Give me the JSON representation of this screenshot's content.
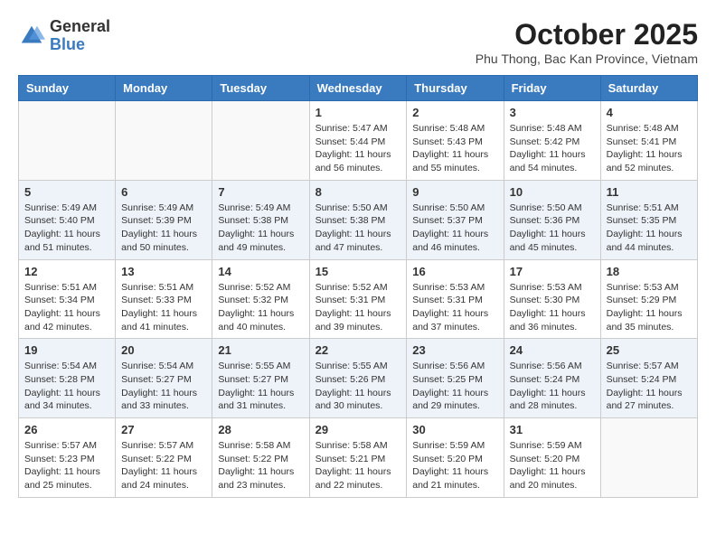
{
  "logo": {
    "general": "General",
    "blue": "Blue"
  },
  "title": "October 2025",
  "location": "Phu Thong, Bac Kan Province, Vietnam",
  "weekdays": [
    "Sunday",
    "Monday",
    "Tuesday",
    "Wednesday",
    "Thursday",
    "Friday",
    "Saturday"
  ],
  "weeks": [
    [
      {
        "day": "",
        "info": ""
      },
      {
        "day": "",
        "info": ""
      },
      {
        "day": "",
        "info": ""
      },
      {
        "day": "1",
        "info": "Sunrise: 5:47 AM\nSunset: 5:44 PM\nDaylight: 11 hours and 56 minutes."
      },
      {
        "day": "2",
        "info": "Sunrise: 5:48 AM\nSunset: 5:43 PM\nDaylight: 11 hours and 55 minutes."
      },
      {
        "day": "3",
        "info": "Sunrise: 5:48 AM\nSunset: 5:42 PM\nDaylight: 11 hours and 54 minutes."
      },
      {
        "day": "4",
        "info": "Sunrise: 5:48 AM\nSunset: 5:41 PM\nDaylight: 11 hours and 52 minutes."
      }
    ],
    [
      {
        "day": "5",
        "info": "Sunrise: 5:49 AM\nSunset: 5:40 PM\nDaylight: 11 hours and 51 minutes."
      },
      {
        "day": "6",
        "info": "Sunrise: 5:49 AM\nSunset: 5:39 PM\nDaylight: 11 hours and 50 minutes."
      },
      {
        "day": "7",
        "info": "Sunrise: 5:49 AM\nSunset: 5:38 PM\nDaylight: 11 hours and 49 minutes."
      },
      {
        "day": "8",
        "info": "Sunrise: 5:50 AM\nSunset: 5:38 PM\nDaylight: 11 hours and 47 minutes."
      },
      {
        "day": "9",
        "info": "Sunrise: 5:50 AM\nSunset: 5:37 PM\nDaylight: 11 hours and 46 minutes."
      },
      {
        "day": "10",
        "info": "Sunrise: 5:50 AM\nSunset: 5:36 PM\nDaylight: 11 hours and 45 minutes."
      },
      {
        "day": "11",
        "info": "Sunrise: 5:51 AM\nSunset: 5:35 PM\nDaylight: 11 hours and 44 minutes."
      }
    ],
    [
      {
        "day": "12",
        "info": "Sunrise: 5:51 AM\nSunset: 5:34 PM\nDaylight: 11 hours and 42 minutes."
      },
      {
        "day": "13",
        "info": "Sunrise: 5:51 AM\nSunset: 5:33 PM\nDaylight: 11 hours and 41 minutes."
      },
      {
        "day": "14",
        "info": "Sunrise: 5:52 AM\nSunset: 5:32 PM\nDaylight: 11 hours and 40 minutes."
      },
      {
        "day": "15",
        "info": "Sunrise: 5:52 AM\nSunset: 5:31 PM\nDaylight: 11 hours and 39 minutes."
      },
      {
        "day": "16",
        "info": "Sunrise: 5:53 AM\nSunset: 5:31 PM\nDaylight: 11 hours and 37 minutes."
      },
      {
        "day": "17",
        "info": "Sunrise: 5:53 AM\nSunset: 5:30 PM\nDaylight: 11 hours and 36 minutes."
      },
      {
        "day": "18",
        "info": "Sunrise: 5:53 AM\nSunset: 5:29 PM\nDaylight: 11 hours and 35 minutes."
      }
    ],
    [
      {
        "day": "19",
        "info": "Sunrise: 5:54 AM\nSunset: 5:28 PM\nDaylight: 11 hours and 34 minutes."
      },
      {
        "day": "20",
        "info": "Sunrise: 5:54 AM\nSunset: 5:27 PM\nDaylight: 11 hours and 33 minutes."
      },
      {
        "day": "21",
        "info": "Sunrise: 5:55 AM\nSunset: 5:27 PM\nDaylight: 11 hours and 31 minutes."
      },
      {
        "day": "22",
        "info": "Sunrise: 5:55 AM\nSunset: 5:26 PM\nDaylight: 11 hours and 30 minutes."
      },
      {
        "day": "23",
        "info": "Sunrise: 5:56 AM\nSunset: 5:25 PM\nDaylight: 11 hours and 29 minutes."
      },
      {
        "day": "24",
        "info": "Sunrise: 5:56 AM\nSunset: 5:24 PM\nDaylight: 11 hours and 28 minutes."
      },
      {
        "day": "25",
        "info": "Sunrise: 5:57 AM\nSunset: 5:24 PM\nDaylight: 11 hours and 27 minutes."
      }
    ],
    [
      {
        "day": "26",
        "info": "Sunrise: 5:57 AM\nSunset: 5:23 PM\nDaylight: 11 hours and 25 minutes."
      },
      {
        "day": "27",
        "info": "Sunrise: 5:57 AM\nSunset: 5:22 PM\nDaylight: 11 hours and 24 minutes."
      },
      {
        "day": "28",
        "info": "Sunrise: 5:58 AM\nSunset: 5:22 PM\nDaylight: 11 hours and 23 minutes."
      },
      {
        "day": "29",
        "info": "Sunrise: 5:58 AM\nSunset: 5:21 PM\nDaylight: 11 hours and 22 minutes."
      },
      {
        "day": "30",
        "info": "Sunrise: 5:59 AM\nSunset: 5:20 PM\nDaylight: 11 hours and 21 minutes."
      },
      {
        "day": "31",
        "info": "Sunrise: 5:59 AM\nSunset: 5:20 PM\nDaylight: 11 hours and 20 minutes."
      },
      {
        "day": "",
        "info": ""
      }
    ]
  ]
}
